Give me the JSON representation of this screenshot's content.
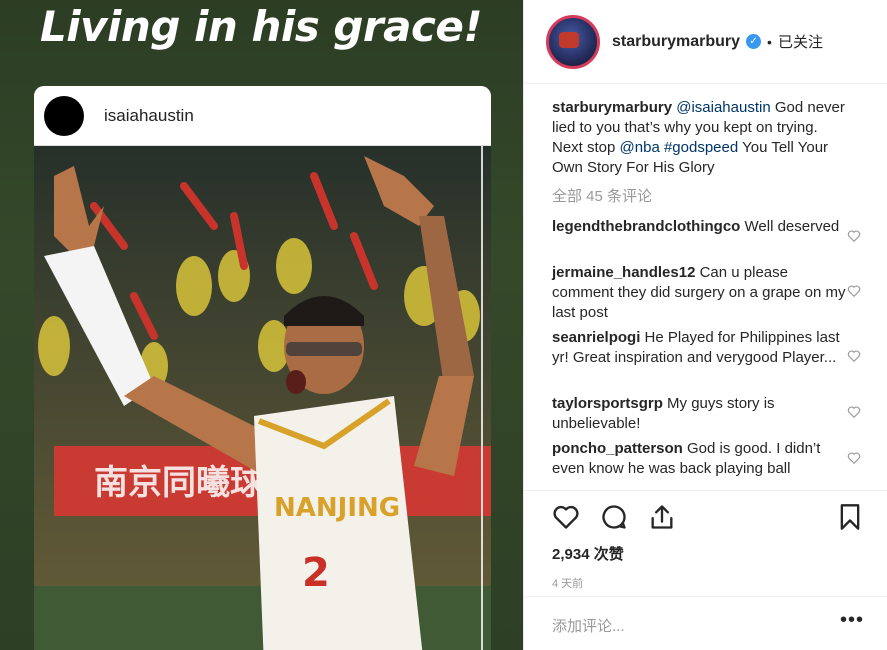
{
  "story": {
    "title": "Living in his grace!",
    "card": {
      "username": "isaiahaustin",
      "jersey_text": "NANJING",
      "jersey_number": "2"
    }
  },
  "panel": {
    "header": {
      "username": "starburymarbury",
      "follow_label": "已关注"
    },
    "caption": {
      "username": "starburymarbury",
      "mention1": "@isaiahaustin",
      "text1": " God never lied to you that’s why you kept on trying. Next stop ",
      "mention2": "@nba",
      "hashtag": "#godspeed",
      "text2": " You Tell Your Own Story For His Glory"
    },
    "view_all": "全部 45 条评论",
    "comments": [
      {
        "username": "legendthebrandclothingco",
        "text": " Well deserved"
      },
      {
        "username": "jermaine_handles12",
        "text": " Can u please comment they did surgery on a grape on my last post"
      },
      {
        "username": "seanrielpogi",
        "text": " He Played for Philippines last yr! Great inspiration and verygood Player..."
      },
      {
        "username": "taylorsportsgrp",
        "text": " My guys story is unbelievable!"
      },
      {
        "username": "poncho_patterson",
        "text": " God is good. I didn’t even know he was back playing ball"
      }
    ],
    "likes": "2,934 次赞",
    "time_ago": "4 天前",
    "add_comment_placeholder": "添加评论...",
    "more_label": "•••",
    "icons": [
      "heart-icon",
      "comment-icon",
      "share-icon",
      "bookmark-icon"
    ]
  },
  "colors": {
    "mention": "#003569",
    "verified": "#3897f0",
    "story_bg": "#34492a"
  }
}
